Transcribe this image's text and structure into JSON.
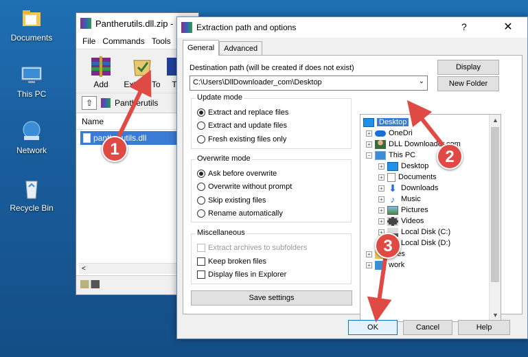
{
  "desktop": {
    "icons": [
      {
        "label": "Documents",
        "icon": "documents-folder-icon"
      },
      {
        "label": "This PC",
        "icon": "this-pc-icon"
      },
      {
        "label": "Network",
        "icon": "network-icon"
      },
      {
        "label": "Recycle Bin",
        "icon": "recycle-bin-icon"
      }
    ]
  },
  "winrar": {
    "title": "Pantherutils.dll.zip -",
    "menu": [
      "File",
      "Commands",
      "Tools"
    ],
    "toolbar": {
      "add_label": "Add",
      "extract_label": "Extract To",
      "third_label": "T"
    },
    "address": "Pantherutils",
    "column_name": "Name",
    "file_name": "pantherutils.dll"
  },
  "dialog": {
    "title": "Extraction path and options",
    "help_glyph": "?",
    "close_glyph": "✕",
    "tabs": {
      "general": "General",
      "advanced": "Advanced"
    },
    "dest_label": "Destination path (will be created if does not exist)",
    "dest_value": "C:\\Users\\DllDownloader_com\\Desktop",
    "display_button": "Display",
    "new_folder_button": "New Folder",
    "update_mode": {
      "title": "Update mode",
      "options": [
        "Extract and replace files",
        "Extract and update files",
        "Fresh existing files only"
      ],
      "selected": 0
    },
    "overwrite_mode": {
      "title": "Overwrite mode",
      "options": [
        "Ask before overwrite",
        "Overwrite without prompt",
        "Skip existing files",
        "Rename automatically"
      ],
      "selected": 0
    },
    "misc": {
      "title": "Miscellaneous",
      "options": [
        "Extract archives to subfolders",
        "Keep broken files",
        "Display files in Explorer"
      ]
    },
    "save_settings": "Save settings",
    "ok": "OK",
    "cancel": "Cancel",
    "help": "Help",
    "tree": {
      "desktop": "Desktop",
      "onedrive": "OneDri",
      "user": "DLL Downloader.com",
      "thispc": "This PC",
      "pc_children": [
        "Desktop",
        "Documents",
        "Downloads",
        "Music",
        "Pictures",
        "Videos",
        "Local Disk (C:)",
        "Local Disk (D:)"
      ],
      "libraries": "aries",
      "network": "work"
    }
  },
  "annotations": {
    "m1": "1",
    "m2": "2",
    "m3": "3",
    "color": "#e04a45"
  }
}
